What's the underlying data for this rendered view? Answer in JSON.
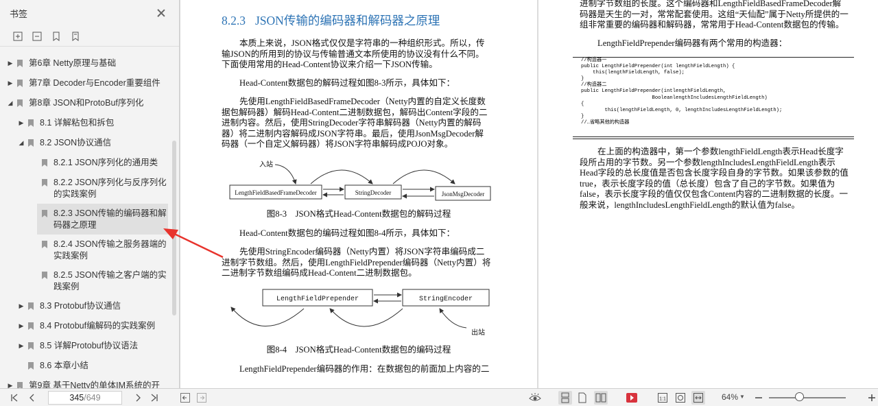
{
  "sidebar": {
    "title": "书签",
    "toc": [
      {
        "label": "第6章 Netty原理与基础",
        "level": 0,
        "expand": "collapsed"
      },
      {
        "label": "第7章 Decoder与Encoder重要组件",
        "level": 0,
        "expand": "collapsed"
      },
      {
        "label": "第8章 JSON和ProtoBuf序列化",
        "level": 0,
        "expand": "expanded"
      },
      {
        "label": "8.1 详解粘包和拆包",
        "level": 1,
        "expand": "collapsed"
      },
      {
        "label": "8.2 JSON协议通信",
        "level": 1,
        "expand": "expanded"
      },
      {
        "label": "8.2.1 JSON序列化的通用类",
        "level": 2,
        "expand": "none"
      },
      {
        "label": "8.2.2 JSON序列化与反序列化的实践案例",
        "level": 2,
        "expand": "none"
      },
      {
        "label": "8.2.3 JSON传输的编码器和解码器之原理",
        "level": 2,
        "expand": "none",
        "selected": true
      },
      {
        "label": "8.2.4 JSON传输之服务器端的实践案例",
        "level": 2,
        "expand": "none"
      },
      {
        "label": "8.2.5 JSON传输之客户端的实践案例",
        "level": 2,
        "expand": "none"
      },
      {
        "label": "8.3 Protobuf协议通信",
        "level": 1,
        "expand": "collapsed"
      },
      {
        "label": "8.4 Protobuf编解码的实践案例",
        "level": 1,
        "expand": "collapsed"
      },
      {
        "label": "8.5 详解Protobuf协议语法",
        "level": 1,
        "expand": "collapsed"
      },
      {
        "label": "8.6 本章小结",
        "level": 1,
        "expand": "none"
      },
      {
        "label": "第9章 基于Netty的单体IM系统的开",
        "level": 0,
        "expand": "collapsed"
      }
    ]
  },
  "left_page": {
    "heading_num": "8.2.3",
    "heading_text": "JSON传输的编码器和解码器之原理",
    "para1": [
      "本质上来说，JSON格式仅仅是字符串的一种组织形式。所以，传",
      "输JSON的所用到的协议与传输普通文本所使用的协议没有什么不同。",
      "下面使用常用的Head-Content协议来介绍一下JSON传输。"
    ],
    "para2": "Head-Content数据包的解码过程如图8-3所示，具体如下：",
    "para3": [
      "先使用LengthFieldBasedFrameDecoder（Netty内置的自定义长度数",
      "据包解码器）解码Head-Content二进制数据包，解码出Content字段的二",
      "进制内容。然后，使用StringDecoder字符串解码器（Netty内置的解码",
      "器）将二进制内容解码成JSON字符串。最后，使用JsonMsgDecoder解",
      "码器（一个自定义解码器）将JSON字符串解码成POJO对象。"
    ],
    "fig3": {
      "in_label": "入站",
      "box1": "LengthFieldBasedFrameDecoder",
      "box2": "StringDecoder",
      "box3": "JsonMsgDecoder",
      "caption": "图8-3　JSON格式Head-Content数据包的解码过程"
    },
    "para4": "Head-Content数据包的编码过程如图8-4所示，具体如下：",
    "para5": [
      "先使用StringEncoder编码器（Netty内置）将JSON字符串编码成二",
      "进制字节数组。然后，使用LengthFieldPrepender编码器（Netty内置）将",
      "二进制字节数组编码成Head-Content二进制数据包。"
    ],
    "fig4": {
      "box1": "LengthFieldPrepender",
      "box2": "StringEncoder",
      "out_label": "出站",
      "caption": "图8-4　JSON格式Head-Content数据包的编码过程"
    },
    "para6": "LengthFieldPrepender编码器的作用：在数据包的前面加上内容的二"
  },
  "right_page": {
    "para1": [
      "进制字节数组的长度。这个编码器和LengthFieldBasedFrameDecoder解",
      "码器是天生的一对，常常配套使用。这组“天仙配”属于Netty所提供的一",
      "组非常重要的编码器和解码器，常常用于Head-Content数据包的传输。"
    ],
    "para2": "LengthFieldPrepender编码器有两个常用的构造器：",
    "code": [
      "//构造器一",
      "public LengthFieldPrepender(int lengthFieldLength) {",
      "    this(lengthFieldLength, false);",
      "}",
      "//构造器二",
      "public LengthFieldPrepender(intlengthFieldLength,",
      "                        BooleanlengthIncludesLengthFieldLength)",
      "{",
      "        this(lengthFieldLength, 0, lengthIncludesLengthFieldLength);",
      "}",
      "//…省略其他的构造器"
    ],
    "para3": [
      "在上面的构造器中，第一个参数lengthFieldLength表示Head长度字",
      "段所占用的字节数。另一个参数lengthIncludesLengthFieldLength表示",
      "Head字段的总长度值是否包含长度字段自身的字节数。如果该参数的值",
      "true，表示长度字段的值（总长度）包含了自己的字节数。如果值为",
      "false，表示长度字段的值仅仅包含Content内容的二进制数据的长度。一",
      "般来说，lengthIncludesLengthFieldLength的默认值为false。"
    ]
  },
  "bottombar": {
    "current_page": "345",
    "total_pages": "/649",
    "zoom": "64%",
    "zoom_fraction": 0.39
  },
  "colors": {
    "heading": "#2e74b5",
    "annotation_arrow": "#e8332c",
    "bookmark_read": "#9a9a9a"
  },
  "icons": [
    "close-icon",
    "add-bookmark-icon",
    "delete-bookmark-icon",
    "bookmark-icon",
    "bookmark-outline-icon",
    "first-page-icon",
    "prev-page-icon",
    "next-page-icon",
    "last-page-icon",
    "back-icon",
    "forward-icon",
    "eye-icon",
    "continuous-icon",
    "single-page-icon",
    "two-page-icon",
    "play-icon",
    "actual-size-icon",
    "rotate-icon",
    "fit-width-icon",
    "zoom-out-icon",
    "zoom-in-icon"
  ]
}
